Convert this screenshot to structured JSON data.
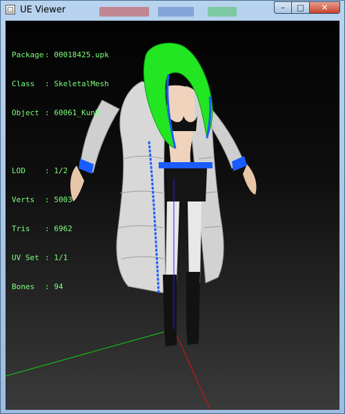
{
  "window": {
    "title": "UE Viewer",
    "controls": {
      "minimize": "–",
      "maximize": "□",
      "close": "✕"
    }
  },
  "info": {
    "package": {
      "label": "Package",
      "value": "00018425.upk"
    },
    "class": {
      "label": "Class",
      "value": "SkeletalMesh"
    },
    "object": {
      "label": "Object",
      "value": "60061_KunN"
    },
    "lod": {
      "label": "LOD",
      "value": "1/2"
    },
    "verts": {
      "label": "Verts",
      "value": "5003"
    },
    "tris": {
      "label": "Tris",
      "value": "6962"
    },
    "uvset": {
      "label": "UV Set",
      "value": "1/1"
    },
    "bones": {
      "label": "Bones",
      "value": "94"
    }
  },
  "colors": {
    "info_text": "#7cff7c",
    "accent_blue": "#1a5cff",
    "hood_green": "#22e622",
    "axis_x": "#e01010",
    "axis_y": "#10d010",
    "axis_z": "#2020ff"
  }
}
